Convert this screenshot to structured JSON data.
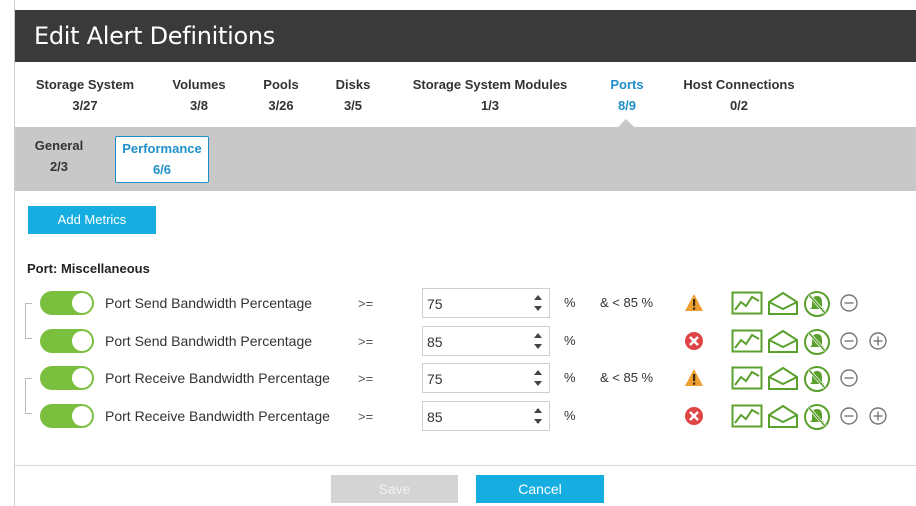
{
  "dialog": {
    "title": "Edit Alert Definitions"
  },
  "top_tabs": [
    {
      "label": "Storage System",
      "count": "3/27",
      "active": false
    },
    {
      "label": "Volumes",
      "count": "3/8",
      "active": false
    },
    {
      "label": "Pools",
      "count": "3/26",
      "active": false
    },
    {
      "label": "Disks",
      "count": "3/5",
      "active": false
    },
    {
      "label": "Storage System Modules",
      "count": "1/3",
      "active": false
    },
    {
      "label": "Ports",
      "count": "8/9",
      "active": true
    },
    {
      "label": "Host Connections",
      "count": "0/2",
      "active": false
    }
  ],
  "sub_tabs": [
    {
      "label": "General",
      "count": "2/3",
      "active": false
    },
    {
      "label": "Performance",
      "count": "6/6",
      "active": true
    }
  ],
  "add_metrics_label": "Add Metrics",
  "section_title": "Port: Miscellaneous",
  "rows": [
    {
      "enabled": true,
      "metric": "Port Send Bandwidth Percentage",
      "operator": ">=",
      "value": "75",
      "unit": "%",
      "range": "& < 85 %",
      "severity": "warning-icon"
    },
    {
      "enabled": true,
      "metric": "Port Send Bandwidth Percentage",
      "operator": ">=",
      "value": "85",
      "unit": "%",
      "range": "",
      "severity": "critical-icon"
    },
    {
      "enabled": true,
      "metric": "Port Receive Bandwidth Percentage",
      "operator": ">=",
      "value": "75",
      "unit": "%",
      "range": "& < 85 %",
      "severity": "warning-icon"
    },
    {
      "enabled": true,
      "metric": "Port Receive Bandwidth Percentage",
      "operator": ">=",
      "value": "85",
      "unit": "%",
      "range": "",
      "severity": "critical-icon"
    }
  ],
  "footer": {
    "save_label": "Save",
    "cancel_label": "Cancel"
  },
  "colors": {
    "title_bar": "#3a3a3a",
    "accent": "#1e8fc8",
    "primary_button": "#16aee0",
    "toggle_on": "#7bbf3e",
    "warning": "#f0a030",
    "critical": "#e04545",
    "action_icon": "#5aa02c"
  }
}
